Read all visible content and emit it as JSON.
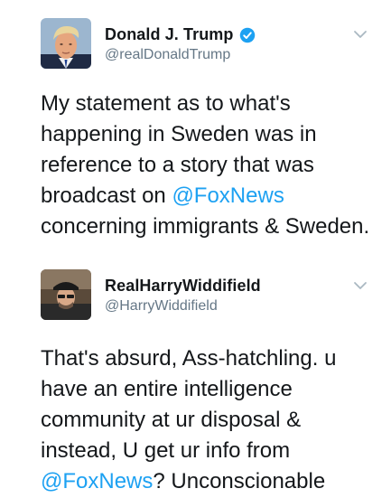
{
  "tweets": [
    {
      "display_name": "Donald J. Trump",
      "handle": "@realDonaldTrump",
      "verified": true,
      "lines": [
        {
          "parts": [
            {
              "text": "My statement as to what's"
            }
          ]
        },
        {
          "parts": [
            {
              "text": "happening in Sweden was in"
            }
          ]
        },
        {
          "parts": [
            {
              "text": "reference to a story that was"
            }
          ]
        },
        {
          "parts": [
            {
              "text": "broadcast on "
            },
            {
              "text": "@FoxNews",
              "mention": true
            }
          ]
        },
        {
          "parts": [
            {
              "text": "concerning immigrants & Sweden."
            }
          ]
        }
      ]
    },
    {
      "display_name": "RealHarryWiddifield",
      "handle": "@HarryWiddifield",
      "verified": false,
      "lines": [
        {
          "parts": [
            {
              "text": "That's absurd, Ass-hatchling. u"
            }
          ]
        },
        {
          "parts": [
            {
              "text": "have an entire intelligence"
            }
          ]
        },
        {
          "parts": [
            {
              "text": "community at ur disposal &"
            }
          ]
        },
        {
          "parts": [
            {
              "text": "instead, U get ur info from"
            }
          ]
        },
        {
          "parts": [
            {
              "text": "@FoxNews",
              "mention": true
            },
            {
              "text": "? Unconscionable"
            }
          ]
        }
      ]
    }
  ],
  "colors": {
    "mention": "#1da1f2",
    "verified_badge": "#1da1f2",
    "handle": "#657786",
    "caret": "#aab8c2"
  },
  "icons": {
    "verified": "verified-badge-icon",
    "menu": "chevron-down-icon"
  }
}
